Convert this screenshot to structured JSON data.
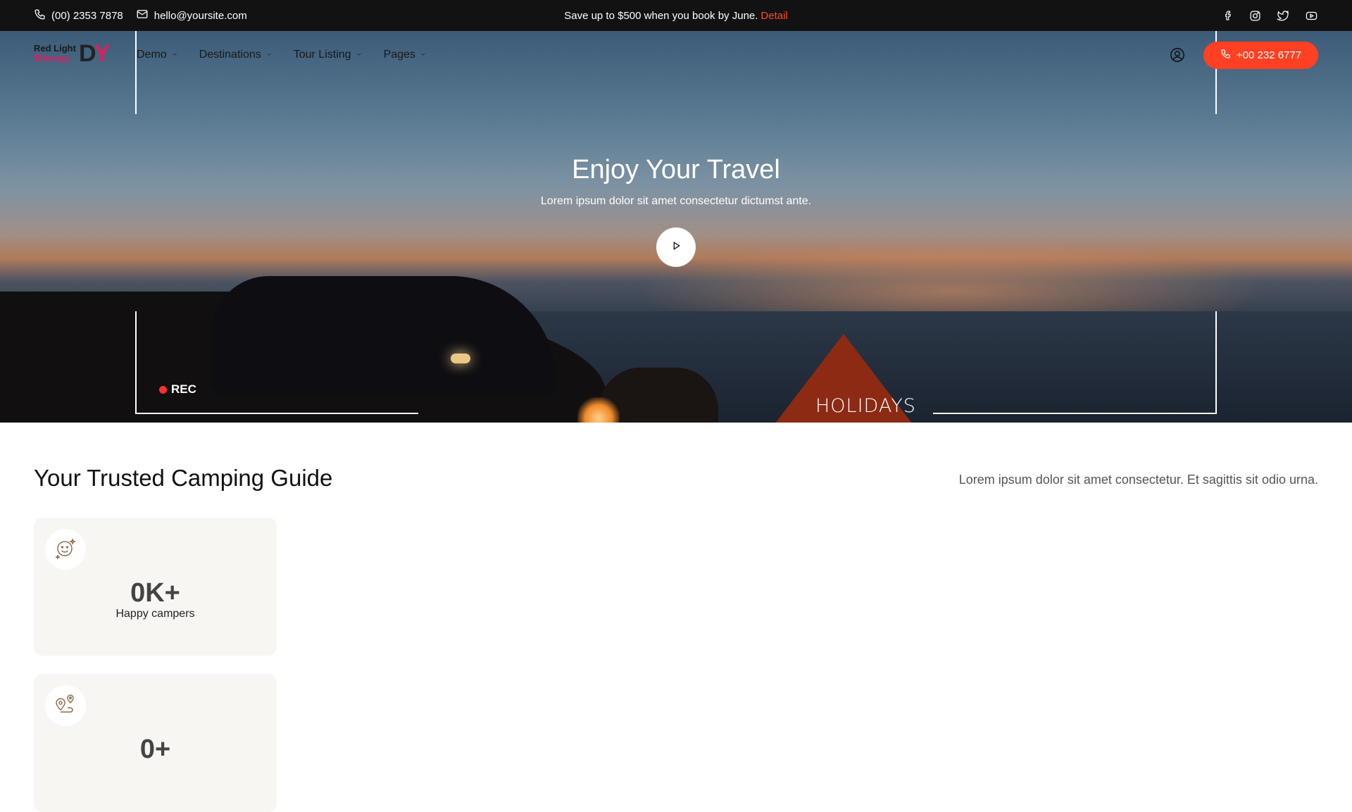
{
  "topbar": {
    "phone": "(00) 2353 7878",
    "email": "hello@yoursite.com",
    "promo_text": "Save up to $500 when you book by June.",
    "promo_link": "Detail",
    "social": [
      "facebook-icon",
      "instagram-icon",
      "twitter-icon",
      "youtube-icon"
    ]
  },
  "header": {
    "logo": {
      "line1": "Red Light",
      "line2": "Therapy",
      "mark_d": "D",
      "mark_y": "Y"
    },
    "nav": [
      {
        "label": "Demo"
      },
      {
        "label": "Destinations"
      },
      {
        "label": "Tour Listing"
      },
      {
        "label": "Pages"
      }
    ],
    "call_label": "+00 232 6777"
  },
  "hero": {
    "title": "Enjoy Your Travel",
    "subtitle": "Lorem ipsum dolor sit amet consectetur dictumst ante.",
    "rec_label": "REC",
    "tag": "HOLIDAYS"
  },
  "section": {
    "title": "Your Trusted Camping Guide",
    "description": "Lorem ipsum dolor sit amet consectetur. Et sagittis sit odio urna."
  },
  "stats": [
    {
      "value": "0K+",
      "label": "Happy campers",
      "icon": "smile-icon"
    },
    {
      "value": "0+",
      "label": "",
      "icon": "location-route-icon"
    }
  ],
  "colors": {
    "accent": "#ff4022",
    "topbar_bg": "#121212",
    "card_bg": "#f8f6f3",
    "brand": "#e51b5a"
  }
}
